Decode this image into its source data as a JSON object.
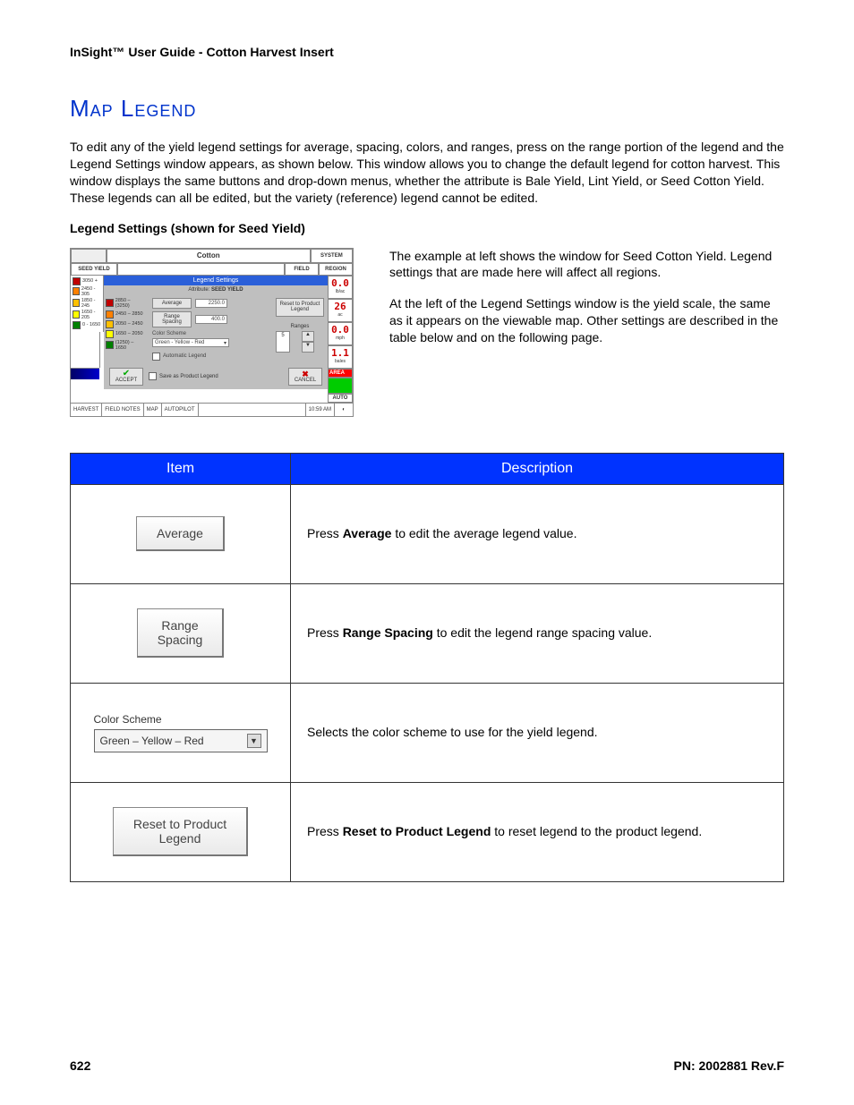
{
  "header": "InSight™ User Guide - Cotton Harvest Insert",
  "title": "Map Legend",
  "intro": "To edit any of the yield legend settings for average, spacing, colors, and ranges, press on the range portion of the legend and the Legend Settings window appears, as shown below. This window allows you to change the default legend for cotton harvest. This window displays the same buttons and drop-down menus, whether the attribute is Bale Yield, Lint Yield, or Seed Cotton Yield. These legends can all be edited, but the variety (reference) legend cannot be edited.",
  "subhead": "Legend Settings (shown for Seed Yield)",
  "right_p1": "The example at left shows the window for Seed Cotton Yield. Legend settings that are made here will affect all regions.",
  "right_p2": "At the left of the Legend Settings window is the yield scale, the same as it appears on the viewable map. Other settings are described in the table below and on the following page.",
  "app": {
    "title": "Cotton",
    "system": "SYSTEM",
    "seed_yield": "SEED YIELD",
    "field": "FIELD",
    "region": "REGION",
    "legend_settings": "Legend Settings",
    "attribute_label": "Attribute:",
    "attribute_value": "SEED YIELD",
    "scale": [
      {
        "c": "#c00000",
        "t": "3050 +"
      },
      {
        "c": "#ff8000",
        "t": "2450 - 305"
      },
      {
        "c": "#ffc000",
        "t": "1850 - 245"
      },
      {
        "c": "#ffff00",
        "t": "1650 - 205"
      },
      {
        "c": "#008000",
        "t": "0 - 1650"
      }
    ],
    "inner_scale": [
      {
        "c": "#c00000",
        "t": "2850 – (3250)"
      },
      {
        "c": "#ff8000",
        "t": "2450 – 2850"
      },
      {
        "c": "#ffc000",
        "t": "2050 – 2450"
      },
      {
        "c": "#ffff00",
        "t": "1650 – 2050"
      },
      {
        "c": "#008000",
        "t": "(1250) – 1650"
      }
    ],
    "average_btn": "Average",
    "average_val": "2250.0",
    "range_btn": "Range Spacing",
    "range_val": "400.0",
    "color_scheme_label": "Color Scheme",
    "color_scheme_value": "Green - Yellow - Red",
    "auto_legend": "Automatic Legend",
    "reset_product": "Reset to Product Legend",
    "ranges_label": "Ranges",
    "ranges_val": "5",
    "accept": "ACCEPT",
    "save_as": "Save as Product Legend",
    "cancel": "CANCEL",
    "meters": [
      {
        "v": "0.0",
        "u": "lb/ac"
      },
      {
        "v": "26",
        "u": "ac"
      },
      {
        "v": "0.0",
        "u": "mph"
      },
      {
        "v": "1.1",
        "u": "bales"
      }
    ],
    "area": "AREA",
    "auto": "AUTO",
    "bottom_tabs": [
      "HARVEST",
      "FIELD NOTES",
      "MAP",
      "AUTOPILOT"
    ],
    "time": "10:59 AM"
  },
  "table": {
    "h1": "Item",
    "h2": "Description",
    "rows": [
      {
        "widget_type": "button",
        "widget_text": "Average",
        "name": "average-button",
        "desc_pre": "Press ",
        "desc_b": "Average",
        "desc_post": " to edit the average legend value."
      },
      {
        "widget_type": "button",
        "widget_text": "Range\nSpacing",
        "name": "range-spacing-button",
        "desc_pre": "Press ",
        "desc_b": "Range Spacing",
        "desc_post": " to edit the legend range spacing value."
      },
      {
        "widget_type": "select",
        "select_label": "Color Scheme",
        "select_value": "Green – Yellow – Red",
        "name": "color-scheme-select",
        "desc_plain": "Selects the color scheme to use for the yield legend."
      },
      {
        "widget_type": "button",
        "widget_text": "Reset to Product\nLegend",
        "name": "reset-product-legend-button",
        "desc_pre": "Press ",
        "desc_b": "Reset to Product Legend",
        "desc_post": " to reset legend to the product legend."
      }
    ]
  },
  "footer": {
    "page": "622",
    "pn": "PN: 2002881 Rev.F"
  }
}
